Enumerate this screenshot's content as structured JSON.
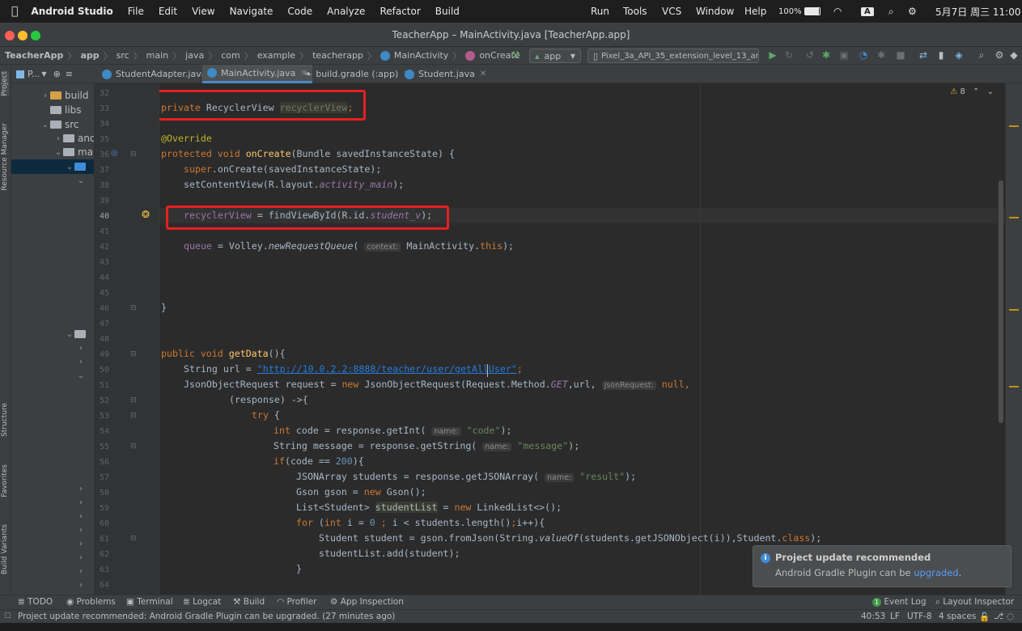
{
  "menubar": {
    "app": "Android Studio",
    "items": [
      "File",
      "Edit",
      "View",
      "Navigate",
      "Code",
      "Analyze",
      "Refactor",
      "Build"
    ],
    "right_items": [
      "Run",
      "Tools",
      "VCS",
      "Window",
      "Help"
    ],
    "battery": "100%",
    "input_method": "A",
    "datetime": "5月7日 周三 11:00"
  },
  "window": {
    "title": "TeacherApp – MainActivity.java [TeacherApp.app]"
  },
  "breadcrumb": [
    "TeacherApp",
    "app",
    "src",
    "main",
    "java",
    "com",
    "example",
    "teacherapp",
    "MainActivity",
    "onCreate"
  ],
  "run_config": "app",
  "device": "Pixel_3a_API_35_extension_level_13_ar",
  "project_dropdown": "P...",
  "tabs": [
    {
      "label": "StudentAdapter.java"
    },
    {
      "label": "MainActivity.java"
    },
    {
      "label": "build.gradle (:app)"
    },
    {
      "label": "Student.java"
    }
  ],
  "left_stripe": [
    "Project",
    "Resource Manager",
    "Structure",
    "Favorites",
    "Build Variants"
  ],
  "project_tree": {
    "build": "build",
    "libs": "libs",
    "src": "src",
    "and": "and",
    "ma": "ma"
  },
  "inspection_count": "8",
  "code_lines": [
    {
      "n": "32"
    },
    {
      "n": "33"
    },
    {
      "n": "34"
    },
    {
      "n": "35"
    },
    {
      "n": "36"
    },
    {
      "n": "37"
    },
    {
      "n": "38"
    },
    {
      "n": "39"
    },
    {
      "n": "40"
    },
    {
      "n": "41"
    },
    {
      "n": "42"
    },
    {
      "n": "43"
    },
    {
      "n": "44"
    },
    {
      "n": "45"
    },
    {
      "n": "46"
    },
    {
      "n": "47"
    },
    {
      "n": "48"
    },
    {
      "n": "49"
    },
    {
      "n": "50"
    },
    {
      "n": "51"
    },
    {
      "n": "52"
    },
    {
      "n": "53"
    },
    {
      "n": "54"
    },
    {
      "n": "55"
    },
    {
      "n": "56"
    },
    {
      "n": "57"
    },
    {
      "n": "58"
    },
    {
      "n": "59"
    },
    {
      "n": "60"
    },
    {
      "n": "61"
    },
    {
      "n": "62"
    },
    {
      "n": "63"
    },
    {
      "n": "64"
    }
  ],
  "code": {
    "l33_kw": "private",
    "l33_type": " RecyclerView ",
    "l33_field": "recyclerView",
    "l33_end": ";",
    "l35": "@Override",
    "l36_kw": "protected void ",
    "l36_fn": "onCreate",
    "l36_rest": "(Bundle savedInstanceState) {",
    "l37_kw": "super",
    "l37_rest": ".onCreate(savedInstanceState);",
    "l38_a": "setContentView(R.layout.",
    "l38_b": "activity_main",
    "l38_c": ");",
    "l40_a": "recyclerView",
    "l40_b": " = findViewById(R.id.",
    "l40_c": "student_v",
    "l40_d": ");",
    "l42_a": "queue",
    "l42_b": " = Volley.",
    "l42_c": "newRequestQueue",
    "l42_d": "( ",
    "l42_hint": "context:",
    "l42_e": " MainActivity.",
    "l42_f": "this",
    "l42_g": ");",
    "l46": "}",
    "l49_kw": "public void ",
    "l49_fn": "getData",
    "l49_rest": "(){",
    "l50_a": "String url = ",
    "l50_url": "\"http://10.0.2.2:8888/teacher/user/getAllUser\"",
    "l50_b": ";",
    "l51_a": "JsonObjectRequest request = ",
    "l51_kw": "new",
    "l51_b": " JsonObjectRequest(Request.Method.",
    "l51_c": "GET",
    "l51_d": ",url, ",
    "l51_hint": "jsonRequest:",
    "l51_e": " null",
    "l51_f": ",",
    "l52": "(response) ->{",
    "l53_kw": "try",
    "l53_b": " {",
    "l54_kw": "int",
    "l54_a": " code = response.getInt( ",
    "l54_hint": "name:",
    "l54_str": " \"code\"",
    "l54_b": ");",
    "l55_a": "String message = response.getString( ",
    "l55_hint": "name:",
    "l55_str": " \"message\"",
    "l55_b": ");",
    "l56_kw": "if",
    "l56_a": "(code == ",
    "l56_num": "200",
    "l56_b": "){",
    "l57_a": "JSONArray students = response.getJSONArray( ",
    "l57_hint": "name:",
    "l57_str": " \"result\"",
    "l57_b": ");",
    "l58_a": "Gson gson = ",
    "l58_kw": "new",
    "l58_b": " Gson();",
    "l59_a": "List<Student> ",
    "l59_var": "studentList",
    "l59_b": " = ",
    "l59_kw": "new",
    "l59_c": " LinkedList<>();",
    "l60_kw": "for",
    "l60_a": " (",
    "l60_kw2": "int",
    "l60_b": " i = ",
    "l60_num": "0",
    "l60_c": " ",
    "l60_d": "; ",
    "l60_e": "i < students.length()",
    "l60_f": ";",
    "l60_g": "i++){",
    "l61_a": "Student student = gson.fromJson(String.",
    "l61_b": "valueOf",
    "l61_c": "(students.getJSONObject(i)),Student.",
    "l61_kw": "class",
    "l61_d": ");",
    "l62": "studentList.add(student);",
    "l63": "}"
  },
  "bottom_tools": [
    "TODO",
    "Problems",
    "Terminal",
    "Logcat",
    "Build",
    "Profiler",
    "App Inspection"
  ],
  "bottom_right_tools": [
    "Event Log",
    "Layout Inspector"
  ],
  "event_log_count": "1",
  "status": {
    "message": "Project update recommended: Android Gradle Plugin can be upgraded. (27 minutes ago)",
    "position": "40:53",
    "line_sep": "LF",
    "encoding": "UTF-8",
    "indent": "4 spaces"
  },
  "notification": {
    "title": "Project update recommended",
    "body_prefix": "Android Gradle Plugin can be ",
    "link": "upgraded",
    "body_suffix": "."
  },
  "colors": {
    "highlight_box": "#e8201f",
    "accent": "#4a88c7",
    "keyword": "#cc7832",
    "field": "#9876aa",
    "string": "#6a8759"
  }
}
